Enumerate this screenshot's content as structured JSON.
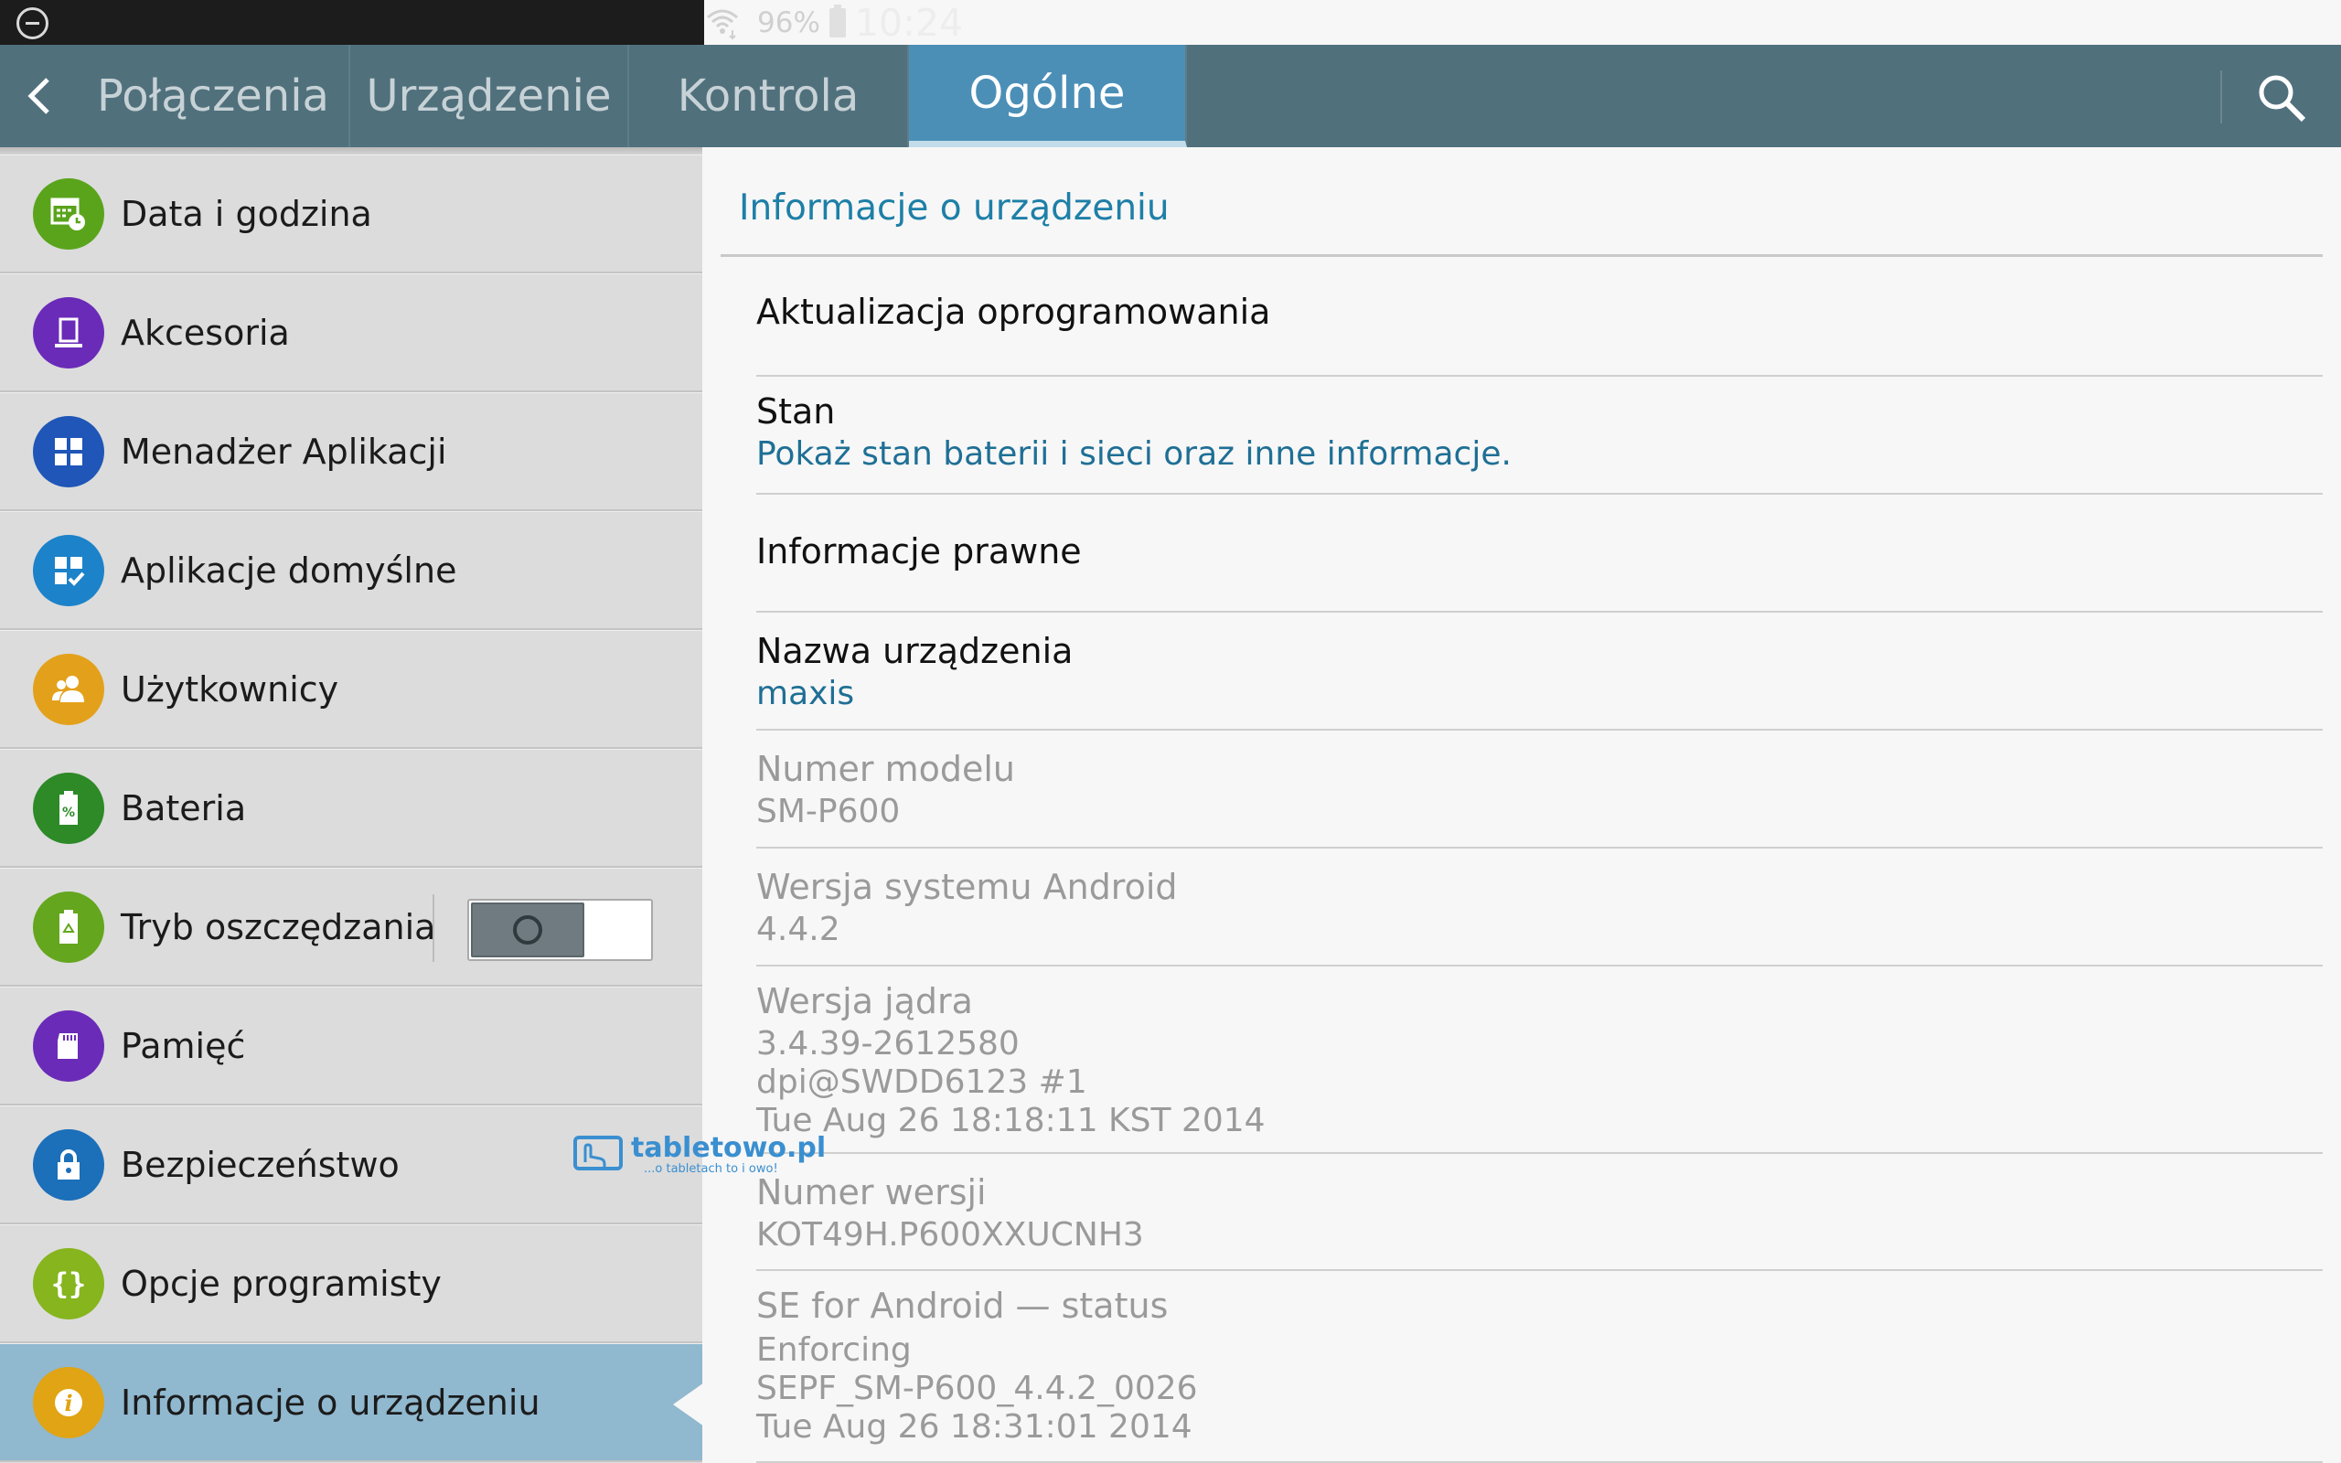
{
  "status_bar": {
    "battery_percent": "96%",
    "time": "10:24",
    "icons": [
      "minus-circle-icon",
      "wifi-icon",
      "battery-icon"
    ]
  },
  "tabs": [
    {
      "label": "Połączenia",
      "active": false
    },
    {
      "label": "Urządzenie",
      "active": false
    },
    {
      "label": "Kontrola",
      "active": false
    },
    {
      "label": "Ogólne",
      "active": true
    }
  ],
  "sidebar": {
    "items": [
      {
        "label": "Data i godzina",
        "icon": "calendar-clock-icon",
        "color": "#5aa41c"
      },
      {
        "label": "Akcesoria",
        "icon": "accessory-icon",
        "color": "#6a2bb8"
      },
      {
        "label": "Menadżer Aplikacji",
        "icon": "apps-grid-icon",
        "color": "#1f56b7"
      },
      {
        "label": "Aplikacje domyślne",
        "icon": "default-apps-icon",
        "color": "#1c82c9"
      },
      {
        "label": "Użytkownicy",
        "icon": "users-icon",
        "color": "#e3a11b"
      },
      {
        "label": "Bateria",
        "icon": "battery-icon",
        "color": "#2d8a27"
      },
      {
        "label": "Tryb oszczędzania",
        "icon": "power-saving-icon",
        "color": "#64a61e",
        "toggle": false
      },
      {
        "label": "Pamięć",
        "icon": "sd-card-icon",
        "color": "#6a2bb8"
      },
      {
        "label": "Bezpieczeństwo",
        "icon": "lock-icon",
        "color": "#1c6fb9"
      },
      {
        "label": "Opcje programisty",
        "icon": "braces-icon",
        "color": "#86b51e"
      },
      {
        "label": "Informacje o urządzeniu",
        "icon": "info-icon",
        "color": "#e0a414",
        "selected": true
      }
    ]
  },
  "main": {
    "title": "Informacje o urządzeniu",
    "rows": [
      {
        "title": "Aktualizacja oprogramowania",
        "subtitle": [],
        "enabled": true
      },
      {
        "title": "Stan",
        "subtitle": [
          "Pokaż stan baterii i sieci oraz inne informacje."
        ],
        "enabled": true
      },
      {
        "title": "Informacje prawne",
        "subtitle": [],
        "enabled": true
      },
      {
        "title": "Nazwa urządzenia",
        "subtitle": [
          "maxis"
        ],
        "enabled": true
      },
      {
        "title": "Numer modelu",
        "subtitle": [
          "SM-P600"
        ],
        "enabled": false
      },
      {
        "title": "Wersja systemu Android",
        "subtitle": [
          "4.4.2"
        ],
        "enabled": false
      },
      {
        "title": "Wersja jądra",
        "subtitle": [
          "3.4.39-2612580",
          "dpi@SWDD6123 #1",
          "Tue Aug 26 18:18:11 KST 2014"
        ],
        "enabled": false
      },
      {
        "title": "Numer wersji",
        "subtitle": [
          "KOT49H.P600XXUCNH3"
        ],
        "enabled": false
      },
      {
        "title": "SE for Android — status",
        "subtitle": [
          "Enforcing",
          "SEPF_SM-P600_4.4.2_0026",
          "Tue Aug 26 18:31:01 2014"
        ],
        "enabled": false
      }
    ]
  },
  "watermark": {
    "main": "tabletowo.pl",
    "sub": "...o tabletach to i owo!"
  },
  "colors": {
    "tabbar": "#50707c",
    "active_tab": "#4b8fb7",
    "accent_text": "#1e7fa7",
    "selected_item": "#90b8cf"
  }
}
